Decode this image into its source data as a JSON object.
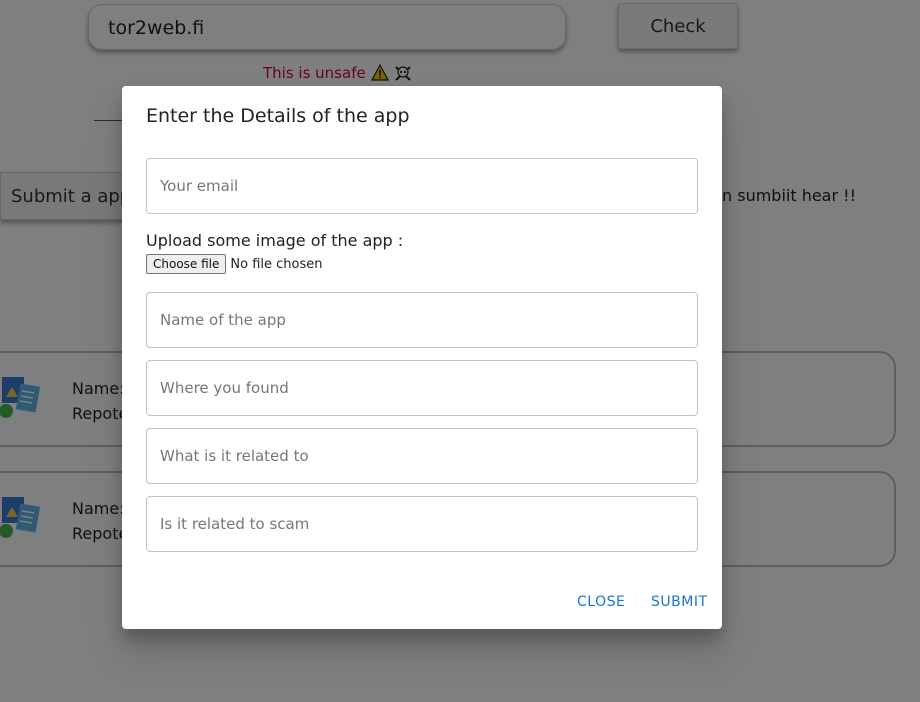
{
  "background": {
    "search_value": "tor2web.fi",
    "check_label": "Check",
    "unsafe_text": "This is unsafe",
    "submit_app_label": "Submit a app",
    "submit_hint": "n sumbiit hear !!",
    "cards": [
      {
        "name_label": "Name:",
        "reported_label": "Repote"
      },
      {
        "name_label": "Name:",
        "reported_label": "Repote"
      }
    ]
  },
  "dialog": {
    "title": "Enter the Details of the app",
    "email_placeholder": "Your email",
    "upload_label": "Upload some image of the app :",
    "choose_file_label": "Choose file",
    "file_status": "No file chosen",
    "app_name_placeholder": "Name of the app",
    "where_found_placeholder": "Where you found",
    "related_placeholder": "What is it related to",
    "scam_placeholder": "Is it related to scam",
    "close_label": "CLOSE",
    "submit_label": "SUBMIT"
  },
  "colors": {
    "accent": "#1976d2",
    "unsafe": "#c8005a",
    "overlay": "rgba(0,0,0,0.5)"
  }
}
